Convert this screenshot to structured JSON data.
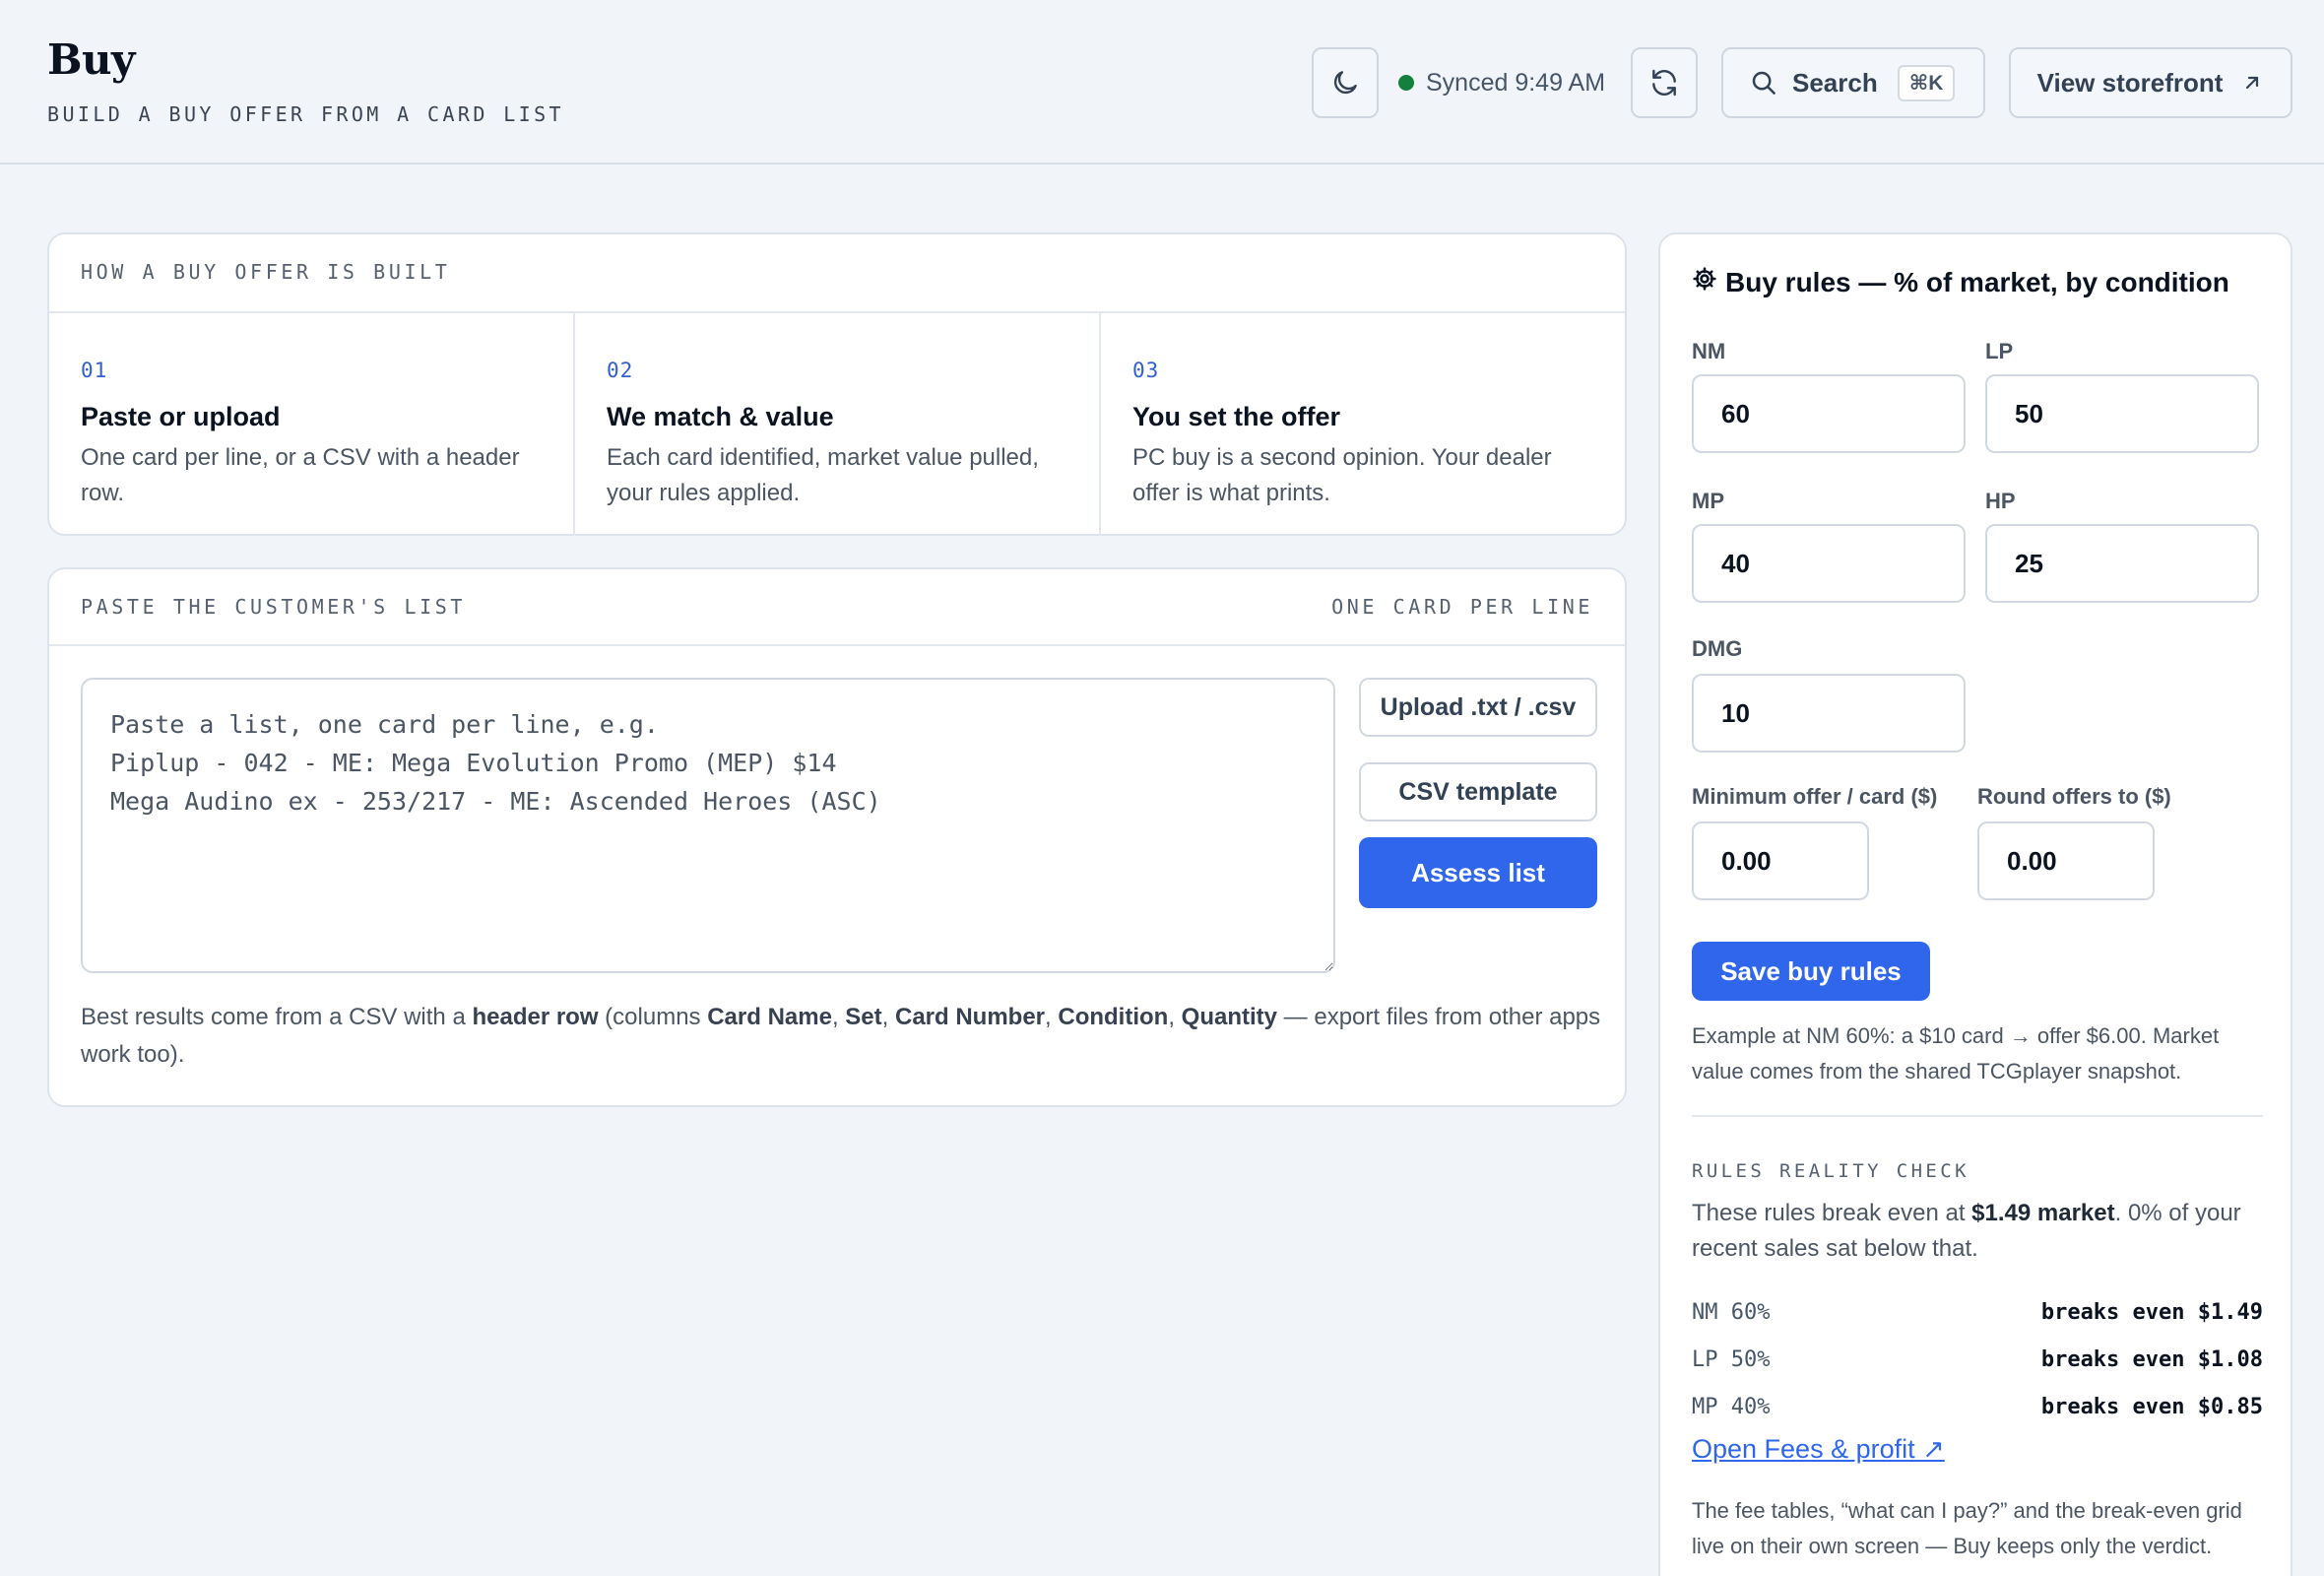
{
  "header": {
    "title": "Buy",
    "subtitle": "BUILD A BUY OFFER FROM A CARD LIST",
    "sync_status": "Synced 9:49 AM",
    "search_label": "Search",
    "search_shortcut": "⌘K",
    "storefront_label": "View storefront"
  },
  "how": {
    "label": "HOW A BUY OFFER IS BUILT",
    "steps": [
      {
        "num": "01",
        "title": "Paste or upload",
        "desc": "One card per line, or a CSV with a header row."
      },
      {
        "num": "02",
        "title": "We match & value",
        "desc": "Each card identified, market value pulled, your rules applied."
      },
      {
        "num": "03",
        "title": "You set the offer",
        "desc": "PC buy is a second opinion. Your dealer offer is what prints."
      }
    ]
  },
  "paste": {
    "label": "PASTE THE CUSTOMER'S LIST",
    "hint": "ONE CARD PER LINE",
    "placeholder": "Paste a list, one card per line, e.g.\nPiplup - 042 - ME: Mega Evolution Promo (MEP) $14\nMega Audino ex - 253/217 - ME: Ascended Heroes (ASC)",
    "value": "",
    "upload_label": "Upload .txt / .csv",
    "csv_template_label": "CSV template",
    "assess_label": "Assess list",
    "note": {
      "t1": "Best results come from a CSV with a ",
      "b1": "header row",
      "t2": " (columns ",
      "c1": "Card Name",
      "s1": ", ",
      "c2": "Set",
      "s2": ", ",
      "c3": "Card Number",
      "s3": ", ",
      "c4": "Condition",
      "s4": ", ",
      "c5": "Quantity",
      "t3": " — export files from other apps work too)."
    }
  },
  "rules": {
    "title": "Buy rules — % of market, by condition",
    "conditions": {
      "nm": {
        "label": "NM",
        "value": "60"
      },
      "lp": {
        "label": "LP",
        "value": "50"
      },
      "mp": {
        "label": "MP",
        "value": "40"
      },
      "hp": {
        "label": "HP",
        "value": "25"
      },
      "dmg": {
        "label": "DMG",
        "value": "10"
      }
    },
    "min_offer": {
      "label": "Minimum offer / card ($)",
      "value": "0.00"
    },
    "round_to": {
      "label": "Round offers to ($)",
      "value": "0.00"
    },
    "save_label": "Save buy rules",
    "example": "Example at NM 60%: a $10 card → offer $6.00. Market value comes from the shared TCGplayer snapshot.",
    "reality": {
      "label": "RULES REALITY CHECK",
      "t1": "These rules break even at ",
      "b1": "$1.49 market",
      "t2": ". 0% of your recent sales sat below that.",
      "rows": [
        {
          "cond": "NM 60%",
          "value": "breaks even $1.49"
        },
        {
          "cond": "LP 50%",
          "value": "breaks even $1.08"
        },
        {
          "cond": "MP 40%",
          "value": "breaks even $0.85"
        }
      ]
    },
    "fees_link": "Open Fees & profit ↗",
    "fees_note": "The fee tables, “what can I pay?” and the break-even grid live on their own screen — Buy keeps only the verdict."
  },
  "colors": {
    "accent": "#2f66eb",
    "sync_ok": "#15803d",
    "background": "#f1f4f8"
  },
  "icons": {
    "theme": "moon-icon",
    "refresh": "refresh-icon",
    "search": "search-icon",
    "storefront": "external-arrow-icon",
    "rules": "gear-icon"
  }
}
